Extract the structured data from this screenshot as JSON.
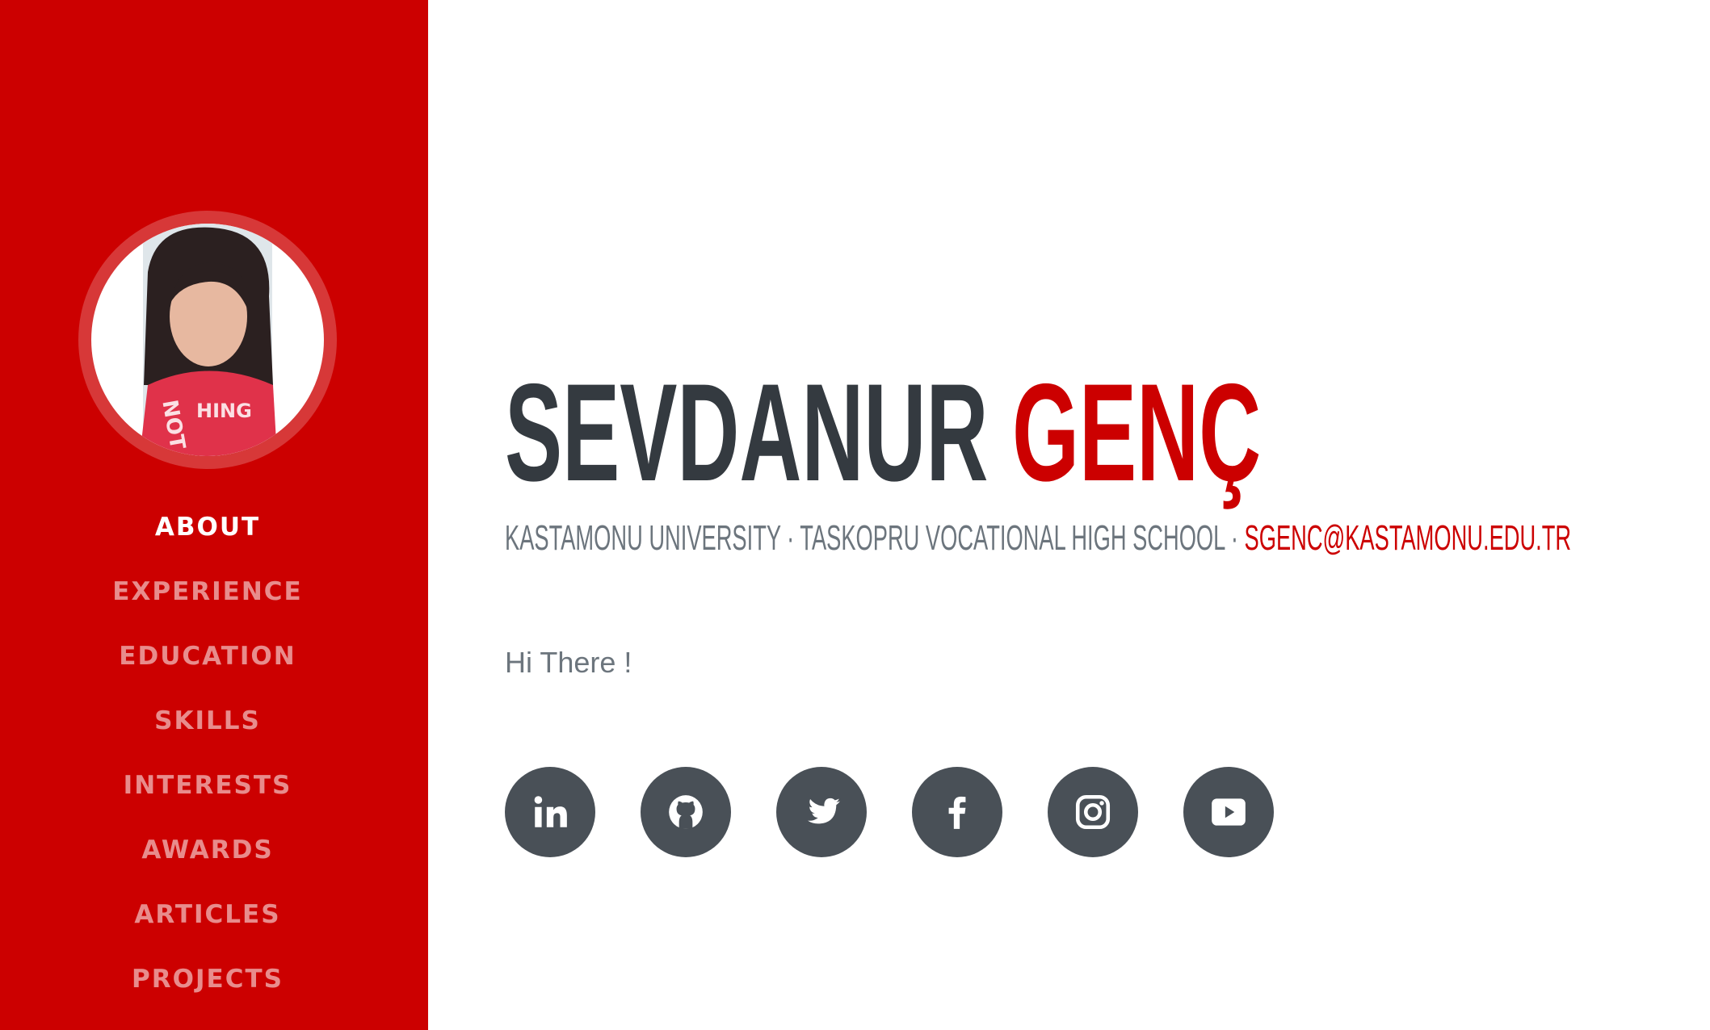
{
  "sidebar": {
    "avatar_alt": "",
    "nav": [
      {
        "label": "ABOUT",
        "active": true
      },
      {
        "label": "EXPERIENCE"
      },
      {
        "label": "EDUCATION"
      },
      {
        "label": "SKILLS"
      },
      {
        "label": "INTERESTS"
      },
      {
        "label": "AWARDS"
      },
      {
        "label": "ARTICLES"
      },
      {
        "label": "PROJECTS"
      }
    ]
  },
  "main": {
    "first_name": "SEVDANUR",
    "last_name": "GENÇ",
    "subheading": "KASTAMONU UNIVERSITY · TASKOPRU VOCATIONAL HIGH SCHOOL · ",
    "email": "SGENC@KASTAMONU.EDU.TR",
    "intro": "Hi There !",
    "social": [
      {
        "icon": "linkedin-icon"
      },
      {
        "icon": "github-icon"
      },
      {
        "icon": "twitter-icon"
      },
      {
        "icon": "facebook-icon"
      },
      {
        "icon": "instagram-icon"
      },
      {
        "icon": "youtube-icon"
      }
    ]
  },
  "colors": {
    "accent": "#cc0000",
    "heading": "#343a40",
    "muted": "#6c757d",
    "social_bg": "#495057"
  }
}
